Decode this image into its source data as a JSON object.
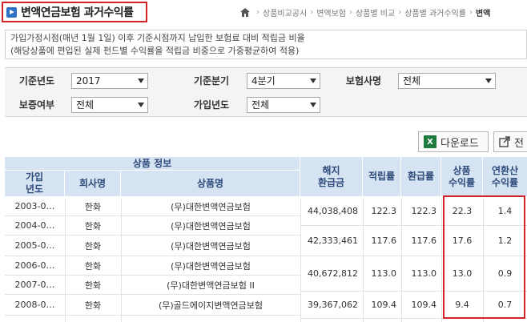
{
  "header": {
    "title": "변액연금보험 과거수익률",
    "breadcrumb": [
      "상품비교공시",
      "변액보험",
      "상품별 비교",
      "상품별 과거수익률",
      "변액"
    ]
  },
  "description": {
    "line1": "가입가정시점(매년 1월 1일) 이후 기준시점까지 납입한 보험료 대비 적립금 비율",
    "line2": "(해당상품에 편입된 실제 펀드별 수익률을 적립금 비중으로 가중평균하여 적용)"
  },
  "filters": {
    "base_year_label": "기준년도",
    "base_year_value": "2017",
    "base_quarter_label": "기준분기",
    "base_quarter_value": "4분기",
    "insurer_label": "보험사명",
    "insurer_value": "전체",
    "guarantee_label": "보증여부",
    "guarantee_value": "전체",
    "join_year_label": "가입년도",
    "join_year_value": "전체"
  },
  "buttons": {
    "download_label": "다운로드",
    "export_label": "전"
  },
  "table": {
    "group_header": "상품 정보",
    "headers": {
      "join_year": "가입\n년도",
      "company": "회사명",
      "product": "상품명",
      "surrender": "해지\n환급금",
      "accum_rate": "적립률",
      "refund_rate": "환급률",
      "product_return": "상품\n수익률",
      "annual_return": "연환산\n수익률"
    },
    "rows": [
      {
        "year": "2003-0…",
        "company": "한화",
        "product": "(무)대한변액연금보험"
      },
      {
        "year": "2004-0…",
        "company": "한화",
        "product": "(무)대한변액연금보험"
      },
      {
        "year": "2005-0…",
        "company": "한화",
        "product": "(무)대한변액연금보험"
      },
      {
        "year": "2006-0…",
        "company": "한화",
        "product": "(무)대한변액연금보험"
      },
      {
        "year": "2007-0…",
        "company": "한화",
        "product": "(무)대한변액연금보험 II"
      },
      {
        "year": "2008-0…",
        "company": "한화",
        "product": "(무)골드에이지변액연금보험"
      }
    ],
    "values": [
      {
        "surrender": "44,038,408",
        "accum": "122.3",
        "refund": "122.3",
        "ret": "22.3",
        "annual": "1.4"
      },
      {
        "surrender": "42,333,461",
        "accum": "117.6",
        "refund": "117.6",
        "ret": "17.6",
        "annual": "1.2"
      },
      {
        "surrender": "40,672,812",
        "accum": "113.0",
        "refund": "113.0",
        "ret": "13.0",
        "annual": "0.9"
      },
      {
        "surrender": "39,367,062",
        "accum": "109.4",
        "refund": "109.4",
        "ret": "9.4",
        "annual": "0.7"
      }
    ]
  }
}
